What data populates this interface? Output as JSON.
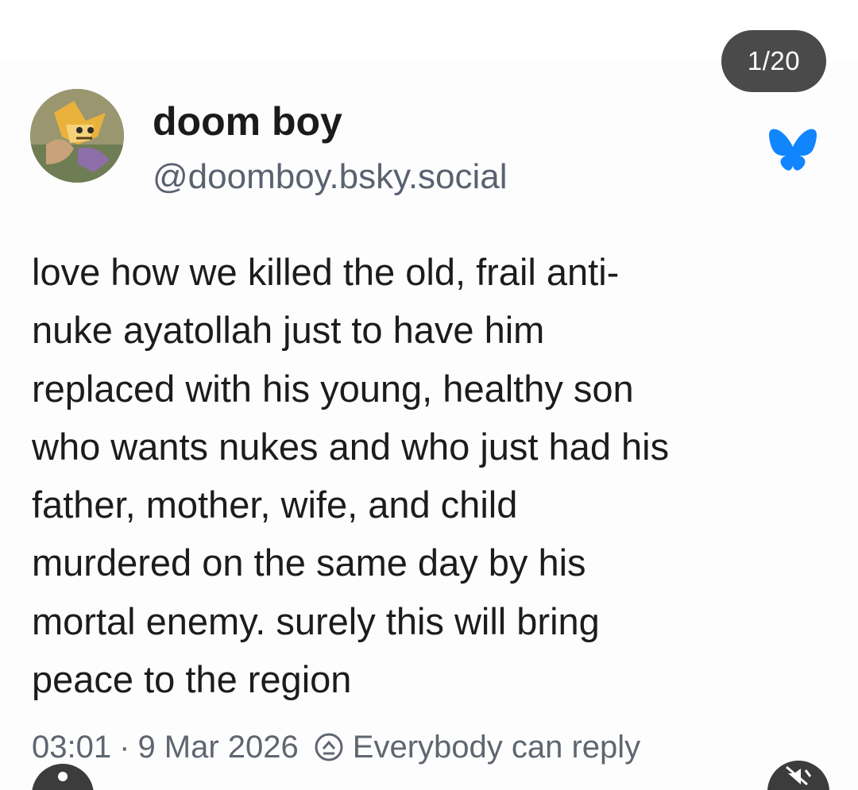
{
  "viewer": {
    "counter": "1/20"
  },
  "post": {
    "author": {
      "display_name": "doom boy",
      "handle": "@doomboy.bsky.social",
      "avatar_icon": "avatar-image"
    },
    "platform_icon": "bluesky-butterfly-icon",
    "platform_color": "#1185fe",
    "text_lines": [
      "love how we killed the old, frail anti-",
      "nuke ayatollah just to have him",
      "replaced with his young, healthy son",
      "who wants nukes and who just had his",
      "father, mother, wife, and child",
      "murdered on the same day by his",
      "mortal enemy. surely this will bring",
      "peace to the region"
    ],
    "time": "03:01",
    "separator": "·",
    "date": "9 Mar 2026",
    "reply_icon": "reply-settings-icon",
    "reply_setting": "Everybody can reply"
  },
  "controls": {
    "left_button_icon": "profile-button-icon",
    "right_button_icon": "mute-button-icon"
  }
}
